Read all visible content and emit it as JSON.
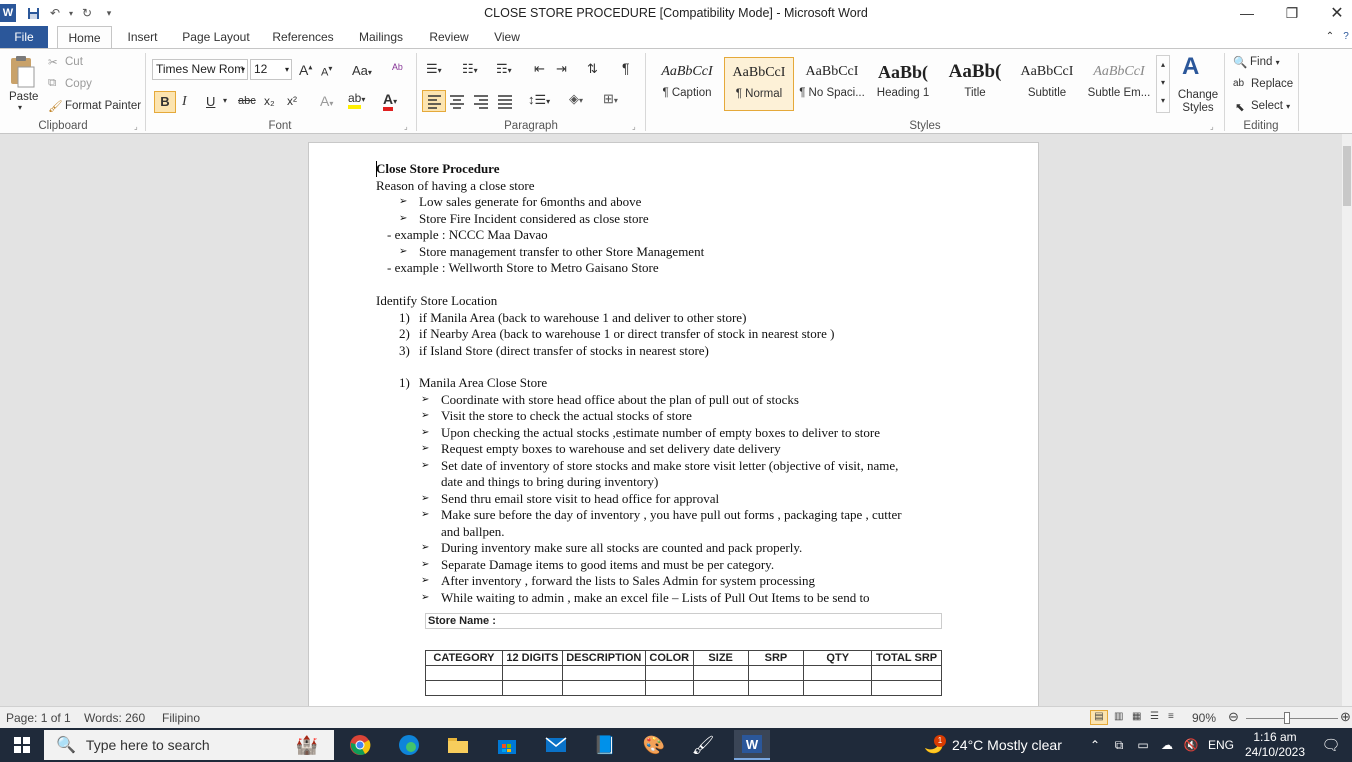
{
  "window": {
    "title": "CLOSE STORE PROCEDURE [Compatibility Mode]  -  Microsoft Word",
    "minimize": "—",
    "restore": "❐",
    "close": "✕"
  },
  "tabs": [
    "File",
    "Home",
    "Insert",
    "Page Layout",
    "References",
    "Mailings",
    "Review",
    "View"
  ],
  "clipboard": {
    "paste": "Paste",
    "cut": "Cut",
    "copy": "Copy",
    "format_painter": "Format Painter",
    "label": "Clipboard"
  },
  "font": {
    "name": "Times New Rom",
    "size": "12",
    "label": "Font",
    "bold": "B",
    "italic": "I",
    "underline": "U",
    "strike": "abc",
    "subscript": "x₂",
    "superscript": "x²",
    "grow": "A",
    "shrink": "A",
    "case": "Aa"
  },
  "paragraph": {
    "label": "Paragraph"
  },
  "styles": {
    "label": "Styles",
    "items": [
      {
        "preview": "AaBbCcI",
        "name": "¶ Caption"
      },
      {
        "preview": "AaBbCcI",
        "name": "¶ Normal"
      },
      {
        "preview": "AaBbCcI",
        "name": "¶ No Spaci..."
      },
      {
        "preview": "AaBb(",
        "name": "Heading 1"
      },
      {
        "preview": "AaBb(",
        "name": "Title"
      },
      {
        "preview": "AaBbCcI",
        "name": "Subtitle"
      },
      {
        "preview": "AaBbCcI",
        "name": "Subtle Em..."
      }
    ],
    "change_styles": "Change Styles"
  },
  "editing": {
    "find": "Find",
    "replace": "Replace",
    "select": "Select",
    "label": "Editing"
  },
  "document": {
    "title": "Close Store Procedure",
    "reason": "Reason  of having  a close store",
    "reason_items": [
      "Low sales generate  for 6months and above",
      "Store Fire Incident  considered  as close store"
    ],
    "example1": "-  example : NCCC  Maa Davao",
    "reason_item3": "Store management transfer to other Store Management",
    "example2": "-  example : Wellworth Store to Metro Gaisano  Store",
    "identify": "Identify Store Location",
    "locations": [
      {
        "num": "1)",
        "text": "if Manila Area (back to warehouse  1 and deliver to other store)"
      },
      {
        "num": "2)",
        "text": "if Nearby Area (back to warehouse  1 or direct transfer of stock in nearest store )"
      },
      {
        "num": "3)",
        "text": "if Island Store (direct transfer of stocks in nearest store)"
      }
    ],
    "manila_num": "1)",
    "manila_heading": "Manila Area Close Store",
    "steps": [
      "Coordinate with store head office about the plan of pull out of stocks",
      "Visit the store to check  the actual stocks of store",
      "Upon checking  the actual stocks ,estimate number of empty boxes to deliver to store",
      "Request  empty boxes to warehouse  and set delivery date delivery",
      "Set date of inventory of store stocks  and make store visit letter (objective of visit, name,",
      "date and things to bring during inventory)",
      "Send thru email store visit to head office for approval",
      "Make sure before the day of inventory , you have pull out forms , packaging  tape , cutter",
      "and ballpen.",
      "During inventory make sure all stocks are counted and pack properly.",
      "Separate Damage items to good items and must be per category.",
      "After inventory , forward the lists to Sales Admin for system processing",
      "While waiting to admin , make an excel file – Lists of Pull Out Items to be send to"
    ],
    "table": {
      "store_name": "Store Name :",
      "headers": [
        "CATEGORY",
        "12 DIGITS",
        "DESCRIPTION",
        "COLOR",
        "SIZE",
        "SRP",
        "QTY",
        "TOTAL SRP"
      ]
    }
  },
  "status": {
    "page": "Page: 1 of 1",
    "words": "Words: 260",
    "language": "Filipino",
    "zoom": "90%"
  },
  "taskbar": {
    "search": "Type here to search",
    "weather": "24°C  Mostly clear",
    "lang": "ENG",
    "time": "1:16 am",
    "date": "24/10/2023",
    "badge": "1"
  }
}
